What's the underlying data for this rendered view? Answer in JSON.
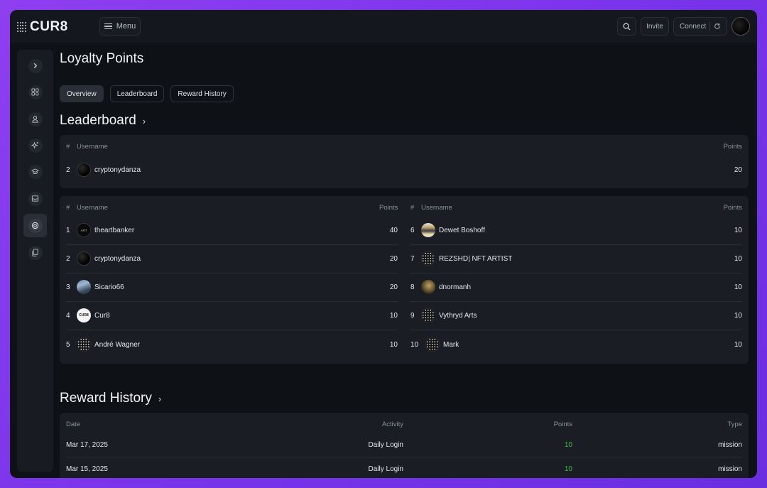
{
  "app": {
    "logo": "CUR8"
  },
  "topbar": {
    "menu_label": "Menu",
    "invite_label": "Invite",
    "connect_label": "Connect"
  },
  "page": {
    "title": "Loyalty Points",
    "tabs": [
      {
        "label": "Overview",
        "active": true
      },
      {
        "label": "Leaderboard",
        "active": false
      },
      {
        "label": "Reward History",
        "active": false
      }
    ]
  },
  "sidebar": {
    "items": [
      {
        "icon": "chevron-right-icon"
      },
      {
        "icon": "dashboard-icon"
      },
      {
        "icon": "user-icon"
      },
      {
        "icon": "sparkles-icon"
      },
      {
        "icon": "graduation-cap-icon"
      },
      {
        "icon": "inbox-icon"
      },
      {
        "icon": "target-icon",
        "active": true
      },
      {
        "icon": "copy-icon"
      }
    ]
  },
  "leaderboard": {
    "title": "Leaderboard",
    "my_rank": {
      "headers": {
        "rank": "#",
        "username": "Username",
        "points": "Points"
      },
      "row": {
        "rank": "2",
        "username": "cryptonydanza",
        "points": "20"
      }
    },
    "table": {
      "headers": {
        "rank": "#",
        "username": "Username",
        "points": "Points"
      },
      "left": [
        {
          "rank": "1",
          "username": "theartbanker",
          "points": "40",
          "avatar": "banker"
        },
        {
          "rank": "2",
          "username": "cryptonydanza",
          "points": "20",
          "avatar": "dark"
        },
        {
          "rank": "3",
          "username": "Sicario66",
          "points": "20",
          "avatar": "photo1"
        },
        {
          "rank": "4",
          "username": "Cur8",
          "points": "10",
          "avatar": "white"
        },
        {
          "rank": "5",
          "username": "André Wagner",
          "points": "10",
          "avatar": "dots"
        }
      ],
      "right": [
        {
          "rank": "6",
          "username": "Dewet Boshoff",
          "points": "10",
          "avatar": "photo2"
        },
        {
          "rank": "7",
          "username": "REZSHD| NFT ARTIST",
          "points": "10",
          "avatar": "dots"
        },
        {
          "rank": "8",
          "username": "dnormanh",
          "points": "10",
          "avatar": "photo3"
        },
        {
          "rank": "9",
          "username": "Vythryd Arts",
          "points": "10",
          "avatar": "dots"
        },
        {
          "rank": "10",
          "username": "Mark",
          "points": "10",
          "avatar": "dots"
        }
      ]
    }
  },
  "reward_history": {
    "title": "Reward History",
    "headers": {
      "date": "Date",
      "activity": "Activity",
      "points": "Points",
      "type": "Type"
    },
    "rows": [
      {
        "date": "Mar 17, 2025",
        "activity": "Daily Login",
        "points": "10",
        "type": "mission"
      },
      {
        "date": "Mar 15, 2025",
        "activity": "Daily Login",
        "points": "10",
        "type": "mission"
      }
    ]
  },
  "colors": {
    "accent_bg": "#8e3ff0",
    "positive": "#3fb950"
  }
}
